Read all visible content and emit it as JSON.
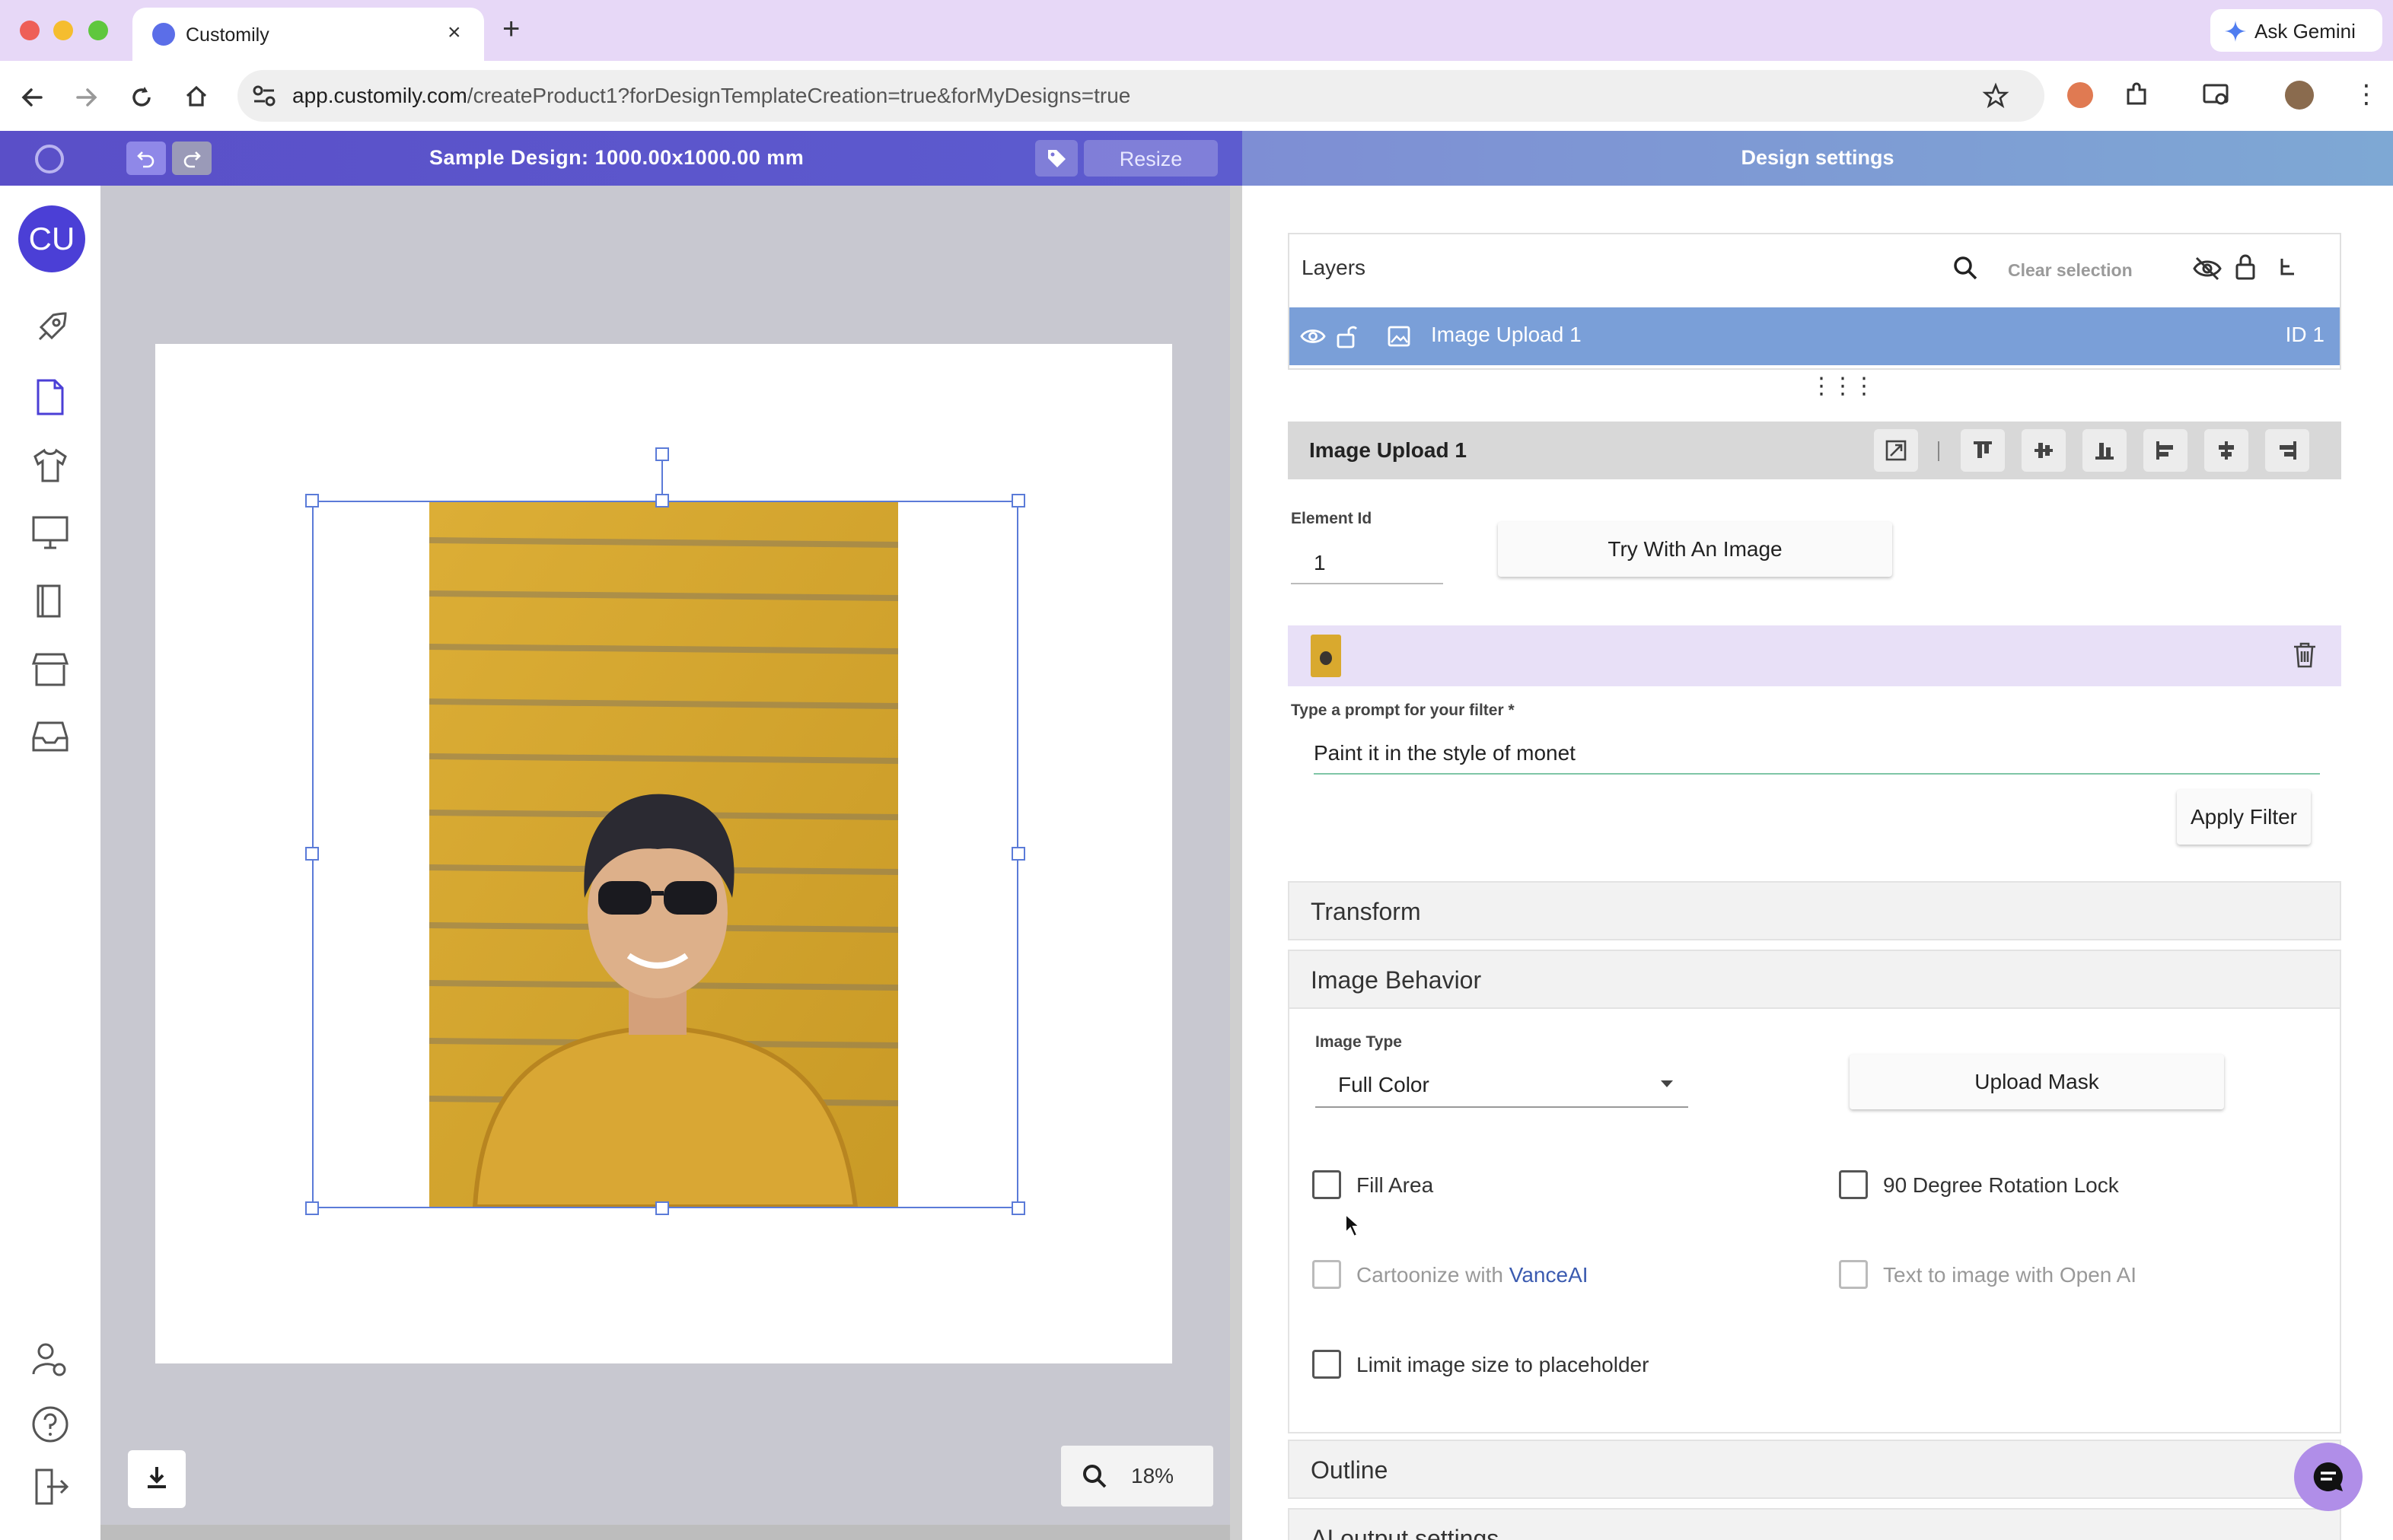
{
  "browser": {
    "tab_title": "Customily",
    "tab_close": "×",
    "new_tab": "+",
    "gemini_label": "Ask Gemini",
    "url_domain": "app.customily.com",
    "url_path": "/createProduct1?forDesignTemplateCreation=true&forMyDesigns=true"
  },
  "app": {
    "design_title": "Sample Design: 1000.00x1000.00 mm",
    "resize_label": "Resize",
    "settings_title": "Design settings",
    "avatar_initials": "CU",
    "zoom": "18%"
  },
  "layers": {
    "title": "Layers",
    "clear_selection": "Clear selection",
    "items": [
      {
        "name": "Image Upload 1",
        "id_label": "ID 1"
      }
    ],
    "drag_handle": "⋮⋮⋮"
  },
  "element": {
    "title": "Image Upload 1",
    "element_id_label": "Element Id",
    "element_id_value": "1",
    "try_image_label": "Try With An Image",
    "prompt_label": "Type a prompt for your filter *",
    "prompt_value": "Paint it in the style of monet",
    "apply_filter_label": "Apply Filter"
  },
  "sections": {
    "transform": "Transform",
    "image_behavior": "Image Behavior",
    "outline": "Outline",
    "ai_output": "AI output settings"
  },
  "behavior": {
    "image_type_label": "Image Type",
    "image_type_value": "Full Color",
    "upload_mask_label": "Upload Mask",
    "fill_area": "Fill Area",
    "rotation_lock": "90 Degree Rotation Lock",
    "cartoonize_prefix": "Cartoonize with ",
    "cartoonize_link": "VanceAI",
    "text_to_image": "Text to image with Open AI",
    "limit_size": "Limit image size to placeholder"
  },
  "colors": {
    "accent": "#5a4fc8",
    "layer_selected": "#7a9fd8",
    "filter_row": "#e8e0f7",
    "photo_bg": "#d8a92c"
  }
}
